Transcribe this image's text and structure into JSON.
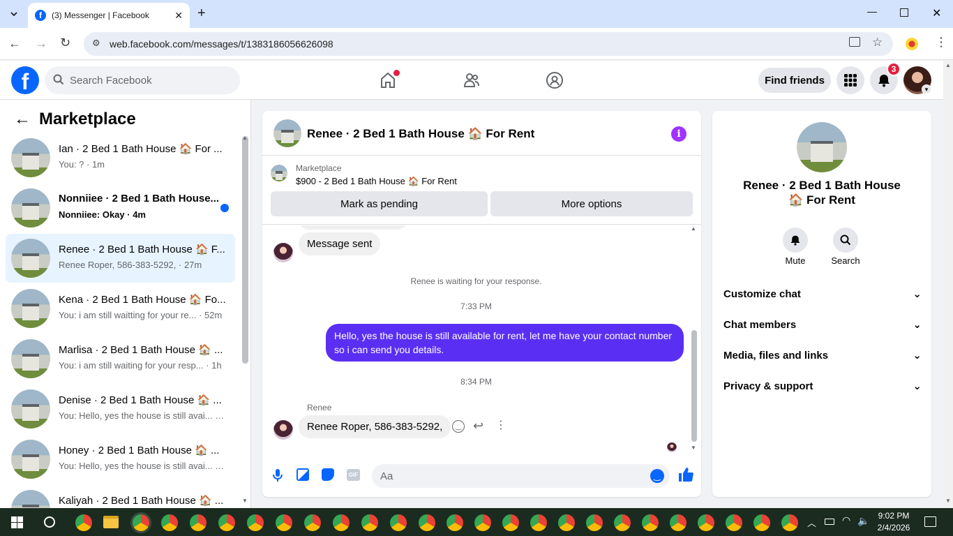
{
  "browser": {
    "tab_title": "(3) Messenger | Facebook",
    "url": "web.facebook.com/messages/t/1383186056626098"
  },
  "header": {
    "search_placeholder": "Search Facebook",
    "find_friends": "Find friends",
    "notification_count": "3"
  },
  "sidebar": {
    "title": "Marketplace",
    "conversations": [
      {
        "title": "Ian · 2 Bed 1 Bath House 🏠 For ...",
        "subtitle": "You: ? · 1m",
        "unread": false,
        "active": false
      },
      {
        "title": "Nonniiee · 2 Bed 1 Bath House...",
        "subtitle": "Nonniiee: Okay · 4m",
        "unread": true,
        "active": false
      },
      {
        "title": "Renee · 2 Bed 1 Bath House 🏠 F...",
        "subtitle": "Renee Roper, 586-383-5292, · 27m",
        "unread": false,
        "active": true
      },
      {
        "title": "Kena · 2 Bed 1 Bath House 🏠 Fo...",
        "subtitle": "You: i am still waitting for your re... · 52m",
        "unread": false,
        "active": false
      },
      {
        "title": "Marlisa · 2 Bed 1 Bath House 🏠 ...",
        "subtitle": "You: i am still waiting for your resp... · 1h",
        "unread": false,
        "active": false
      },
      {
        "title": "Denise · 2 Bed 1 Bath House 🏠 ...",
        "subtitle": "You: Hello, yes the house is still avai... · 1h",
        "unread": false,
        "active": false
      },
      {
        "title": "Honey · 2 Bed 1 Bath House 🏠 ...",
        "subtitle": "You: Hello, yes the house is still avai... · 1h",
        "unread": false,
        "active": false
      },
      {
        "title": "Kaliyah · 2 Bed 1 Bath House 🏠 ...",
        "subtitle": "",
        "unread": false,
        "active": false
      }
    ]
  },
  "chat": {
    "name": "Renee · 2 Bed 1 Bath House 🏠 For Rent",
    "marketplace_label": "Marketplace",
    "listing": "$900 - 2 Bed 1 Bath House 🏠 For Rent",
    "mark_pending": "Mark as pending",
    "more_options": "More options",
    "msg_sent": "Message sent",
    "waiting": "Renee is waiting for your response.",
    "time1": "7:33 PM",
    "outgoing": "Hello, yes the house is still available for rent, let me have your contact number so i can send you  details.",
    "time2": "8:34 PM",
    "sender": "Renee",
    "incoming": "Renee Roper, 586-383-5292,",
    "composer_placeholder": "Aa",
    "gif_label": "GIF"
  },
  "info": {
    "name": "Renee · 2 Bed 1 Bath House 🏠 For Rent",
    "mute": "Mute",
    "search": "Search",
    "rows": [
      "Customize chat",
      "Chat members",
      "Media, files and links",
      "Privacy & support"
    ]
  },
  "taskbar": {
    "time": "9:02 PM",
    "date": "2/4/2026"
  },
  "colors": {
    "fb_blue": "#0866ff",
    "messenger_purple": "#5b2ff3",
    "active_row": "#e7f3ff"
  }
}
